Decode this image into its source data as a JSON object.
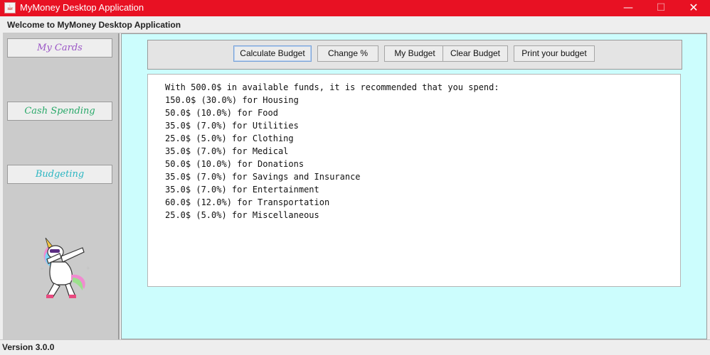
{
  "window": {
    "title": "MyMoney Desktop Application",
    "minimize_glyph": "—",
    "maximize_glyph": "☐",
    "close_glyph": "✕",
    "icon": "java-app-icon"
  },
  "header": {
    "welcome": "Welcome to MyMoney Desktop Application"
  },
  "sidebar": {
    "items": [
      {
        "label": "My Cards",
        "color": "#9a55c6"
      },
      {
        "label": "Cash Spending",
        "color": "#2aa96a"
      },
      {
        "label": "Budgeting",
        "color": "#2bb6c2"
      }
    ],
    "mascot": "dabbing-unicorn-image"
  },
  "toolbar": {
    "calculate_label": "Calculate Budget",
    "change_label": "Change %",
    "my_budget_label": "My Budget",
    "clear_label": "Clear Budget",
    "print_label": "Print your budget"
  },
  "output": {
    "intro": "With 500.0$ in available funds, it is recommended that you spend:",
    "lines": [
      "150.0$ (30.0%) for Housing",
      "50.0$ (10.0%) for Food",
      "35.0$ (7.0%) for Utilities",
      "25.0$ (5.0%) for Clothing",
      "35.0$ (7.0%) for Medical",
      "50.0$ (10.0%) for Donations",
      "35.0$ (7.0%) for Savings and Insurance",
      "35.0$ (7.0%) for Entertainment",
      "60.0$ (12.0%) for Transportation",
      "25.0$ (5.0%) for Miscellaneous"
    ]
  },
  "status": {
    "version": "Version 3.0.0"
  },
  "colors": {
    "titlebar": "#e81123",
    "main_background": "#ccfdfd",
    "sidebar_background": "#cbcbcb"
  }
}
